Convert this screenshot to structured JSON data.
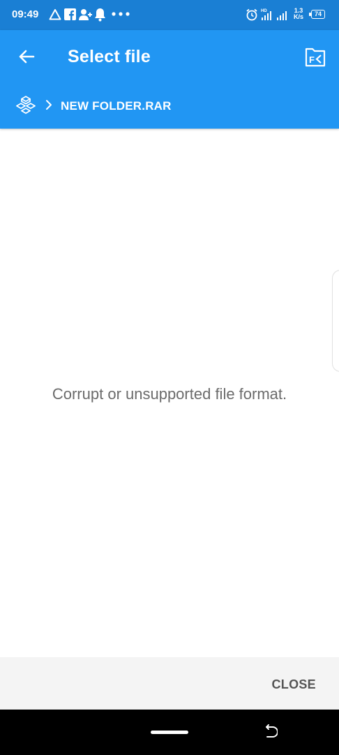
{
  "status_bar": {
    "time": "09:49",
    "net_speed_value": "1.3",
    "net_speed_unit": "K/s",
    "battery": "74"
  },
  "app_bar": {
    "title": "Select file",
    "breadcrumb": [
      "NEW FOLDER.RAR"
    ]
  },
  "content": {
    "message": "Corrupt or unsupported file format."
  },
  "actions": {
    "close_label": "CLOSE"
  },
  "colors": {
    "status_bar": "#1a7fd4",
    "app_bar": "#2196f3",
    "message_text": "#6b6b6b",
    "action_bar": "#f4f4f4"
  }
}
